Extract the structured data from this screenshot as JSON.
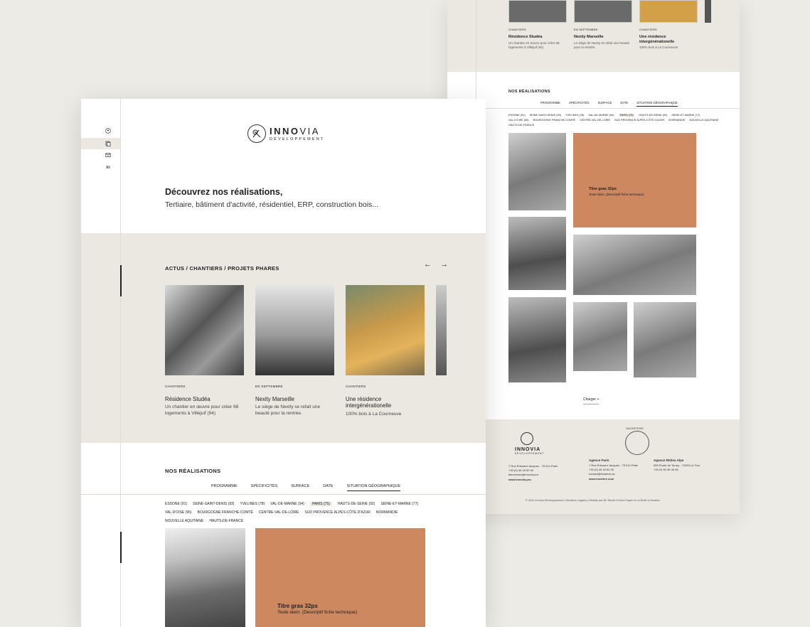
{
  "back": {
    "cards": [
      {
        "cat": "CHANTIERS",
        "title": "Résidence Studéa",
        "desc": "Un chantier en œuvre pour créer 68 logements à Villejuif (94)"
      },
      {
        "cat": "EN SEPTEMBRE",
        "title": "Nexity Marseille",
        "desc": "Le siège de Nexity se refait une beauté pour la rentrée."
      },
      {
        "cat": "CHANTIERS",
        "title": "Une résidence intergénérationelle",
        "desc": "100% bois à La Courneuve"
      }
    ],
    "section_title": "NOS RÉALISATIONS",
    "tabs": [
      "PROGRAMME",
      "SPÉCIFICITÉS",
      "SURFACE",
      "DATE",
      "SITUATION GÉOGRAPHIQUE"
    ],
    "chips": [
      "ESSONE (91)",
      "SEINE-SAINT-DENIS (93)",
      "YVELINES (78)",
      "VAL-DE-MARNE (94)",
      "PARIS (75)",
      "HAUTS-DE-SEINE (92)",
      "SEINE-ET-MARNE (77)",
      "VAL-D'OISE (95)",
      "BOURGOGNE FRANCHE-COMTÉ",
      "CENTRE-VAL-DE-LOIRE",
      "SUD PROVENCE ALPES-CÔTE D'AZUR",
      "NORMANDIE",
      "NOUVELLE AQUITAINE",
      "HAUTS-DE-FRANCE"
    ],
    "feature_title": "Titre gras 32px",
    "feature_desc": "Texte idem. (Descriptif fiche technique)",
    "more": "Charger  +",
    "footer": {
      "logo_name": "INNOVIA",
      "logo_sub": "DÉVELOPPEMENT",
      "col1": [
        "7 Rue Édouard Jacques - 75 014 Paris",
        "+33 (0) 45 43 62 90",
        "bienvenue@innovia.pro",
        "www.innovia.pro"
      ],
      "col2_title": "Agence Paris",
      "col2": [
        "7 Rue Édouard Jacques - 75 014 Paris",
        "+33 (0) 45 43 62 05",
        "contact@inosfere.ca",
        "www.inosfere.com"
      ],
      "col3_title": "Agence Rhône Alpe",
      "col3": [
        "555 Route de Torrey - 74250 La Tour",
        "+33 04 50 35 45 35"
      ],
      "badge": "INOSFERE",
      "copyright": "© 2022 Innovia Développement  |  Mentions Légales  |  Réalisé par BC Studio & Boro Papier et La Boîte à Dessins"
    }
  },
  "front": {
    "logo": {
      "name_bold": "INNO",
      "name_light": "VIA",
      "sub": "DÉVELOPPEMENT"
    },
    "hero_title": "Découvrez nos réalisations,",
    "hero_subtitle": "Tertiaire, bâtiment d'activité, résidentiel, ERP, construction bois...",
    "section_title": "ACTUS / CHANTIERS / PROJETS PHARES",
    "arrow_prev": "←",
    "arrow_next": "→",
    "cards": [
      {
        "cat": "CHANTIERS",
        "title": "Résidence Studéa",
        "desc": "Un chantier en œuvre pour créer 68 logements à Villejuif (94)"
      },
      {
        "cat": "EN SEPTEMBRE",
        "title": "Nexity Marseille",
        "desc": "Le siège de Nexity se refait une beauté pour la rentrée."
      },
      {
        "cat": "CHANTIERS",
        "title": "Une résidence intergénérationelle",
        "desc": "100% bois à La Courneuve"
      }
    ],
    "nos_title": "NOS RÉALISATIONS",
    "tabs": [
      "PROGRAMME",
      "SPÉCIFICITÉS",
      "SURFACE",
      "DATE",
      "SITUATION GÉOGRAPHIQUE"
    ],
    "chips": [
      "ESSONE (91)",
      "SEINE-SAINT-DENIS (93)",
      "YVELINES (78)",
      "VAL-DE-MARNE (94)",
      "PARIS (75)",
      "HAUTS-DE-SEINE (92)",
      "SEINE-ET-MARNE (77)",
      "VAL-D'OISE (95)",
      "BOURGOGNE FRANCHE-COMTÉ",
      "CENTRE-VAL-DE-LOIRE",
      "SUD PROVENCE ALPES-CÔTE D'AZUR",
      "NORMANDIE",
      "NOUVELLE AQUITAINE",
      "HAUTS-DE-FRANCE"
    ],
    "feature_title": "Titre gras 32px",
    "feature_desc": "Texte idem. (Descriptif fiche technique)"
  },
  "colors": {
    "beige": "#ebe8e1",
    "orange": "#cd8860",
    "background": "#edebe5"
  }
}
